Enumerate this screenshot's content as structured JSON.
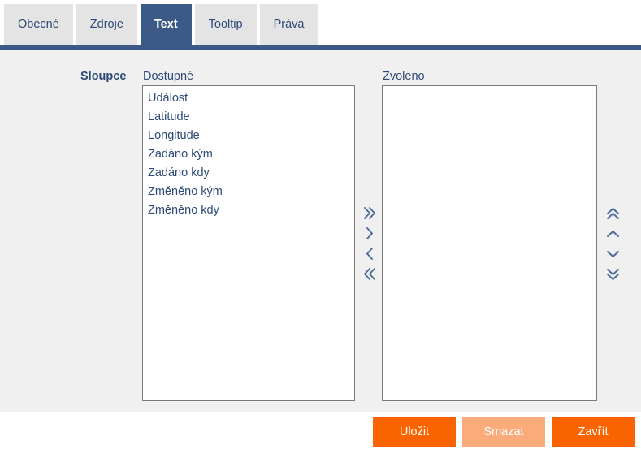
{
  "tabs": [
    {
      "label": "Obecné",
      "active": false
    },
    {
      "label": "Zdroje",
      "active": false
    },
    {
      "label": "Text",
      "active": true
    },
    {
      "label": "Tooltip",
      "active": false
    },
    {
      "label": "Práva",
      "active": false
    }
  ],
  "form": {
    "field_label": "Sloupce",
    "available_caption": "Dostupné",
    "selected_caption": "Zvoleno"
  },
  "available_items": [
    "Událost",
    "Latitude",
    "Longitude",
    "Zadáno kým",
    "Zadáno kdy",
    "Změněno kým",
    "Změněno kdy"
  ],
  "selected_items": [],
  "transfer_buttons": [
    {
      "icon": "double-chevron-right-icon",
      "name": "move-all-right-button"
    },
    {
      "icon": "chevron-right-icon",
      "name": "move-right-button"
    },
    {
      "icon": "chevron-left-icon",
      "name": "move-left-button"
    },
    {
      "icon": "double-chevron-left-icon",
      "name": "move-all-left-button"
    }
  ],
  "order_buttons": [
    {
      "icon": "double-chevron-up-icon",
      "name": "move-top-button"
    },
    {
      "icon": "chevron-up-icon",
      "name": "move-up-button"
    },
    {
      "icon": "chevron-down-icon",
      "name": "move-down-button"
    },
    {
      "icon": "double-chevron-down-icon",
      "name": "move-bottom-button"
    }
  ],
  "footer": {
    "save_label": "Uložit",
    "delete_label": "Smazat",
    "close_label": "Zavřít"
  },
  "colors": {
    "accent_blue": "#3b5a88",
    "text_blue": "#2d4a77",
    "tab_inactive": "#e4e4e4",
    "panel_bg": "#f0f0f0",
    "button_orange": "#fa6400",
    "button_orange_disabled": "#fbab79",
    "listbox_border": "#7a7a7a",
    "arrow_blue": "#4a6a9a"
  }
}
